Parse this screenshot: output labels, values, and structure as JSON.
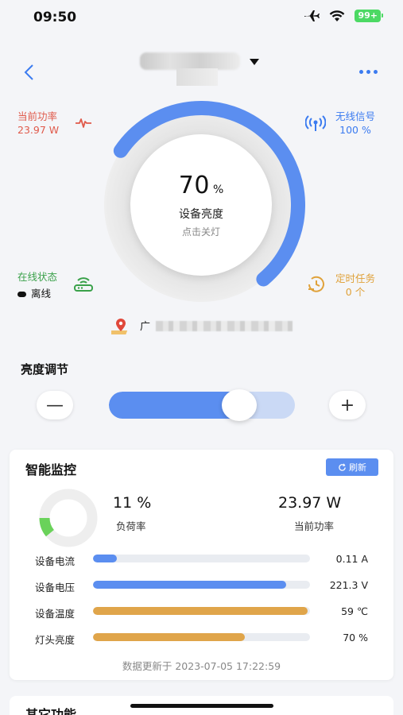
{
  "status_bar": {
    "time": "09:50",
    "battery": "99+"
  },
  "header": {
    "device_name": ""
  },
  "stats": {
    "power_label": "当前功率",
    "power_value": "23.97 W",
    "signal_label": "无线信号",
    "signal_value": "100 %",
    "online_label": "在线状态",
    "online_value": "离线",
    "timer_label": "定时任务",
    "timer_value": "0 个"
  },
  "gauge": {
    "value": "70",
    "unit": "%",
    "level": 0.7,
    "label": "设备亮度",
    "sub_label": "点击关灯"
  },
  "location": {
    "prefix": "广"
  },
  "brightness_control": {
    "title": "亮度调节",
    "minus": "—",
    "plus": "+",
    "level": 0.7
  },
  "monitor": {
    "title": "智能监控",
    "refresh_label": "刷新",
    "load_value": "11 %",
    "load_label": "负荷率",
    "load_level": 0.11,
    "power_value": "23.97 W",
    "power_label": "当前功率",
    "metrics": [
      {
        "label": "设备电流",
        "value": "0.11 A",
        "level": 0.11,
        "color": "#5b8ef0"
      },
      {
        "label": "设备电压",
        "value": "221.3 V",
        "level": 0.89,
        "color": "#5b8ef0"
      },
      {
        "label": "设备温度",
        "value": "59 ℃",
        "level": 0.99,
        "color": "#e0a54a"
      },
      {
        "label": "灯头亮度",
        "value": "70 %",
        "level": 0.7,
        "color": "#e0a54a"
      }
    ],
    "update_text": "数据更新于 2023-07-05 17:22:59"
  },
  "other": {
    "title": "其它功能"
  },
  "colors": {
    "accent": "#3b7bf0",
    "power": "#e05a4b",
    "online": "#3aa14a",
    "timer": "#e0a23b",
    "load_ring": "#6ad25a"
  }
}
